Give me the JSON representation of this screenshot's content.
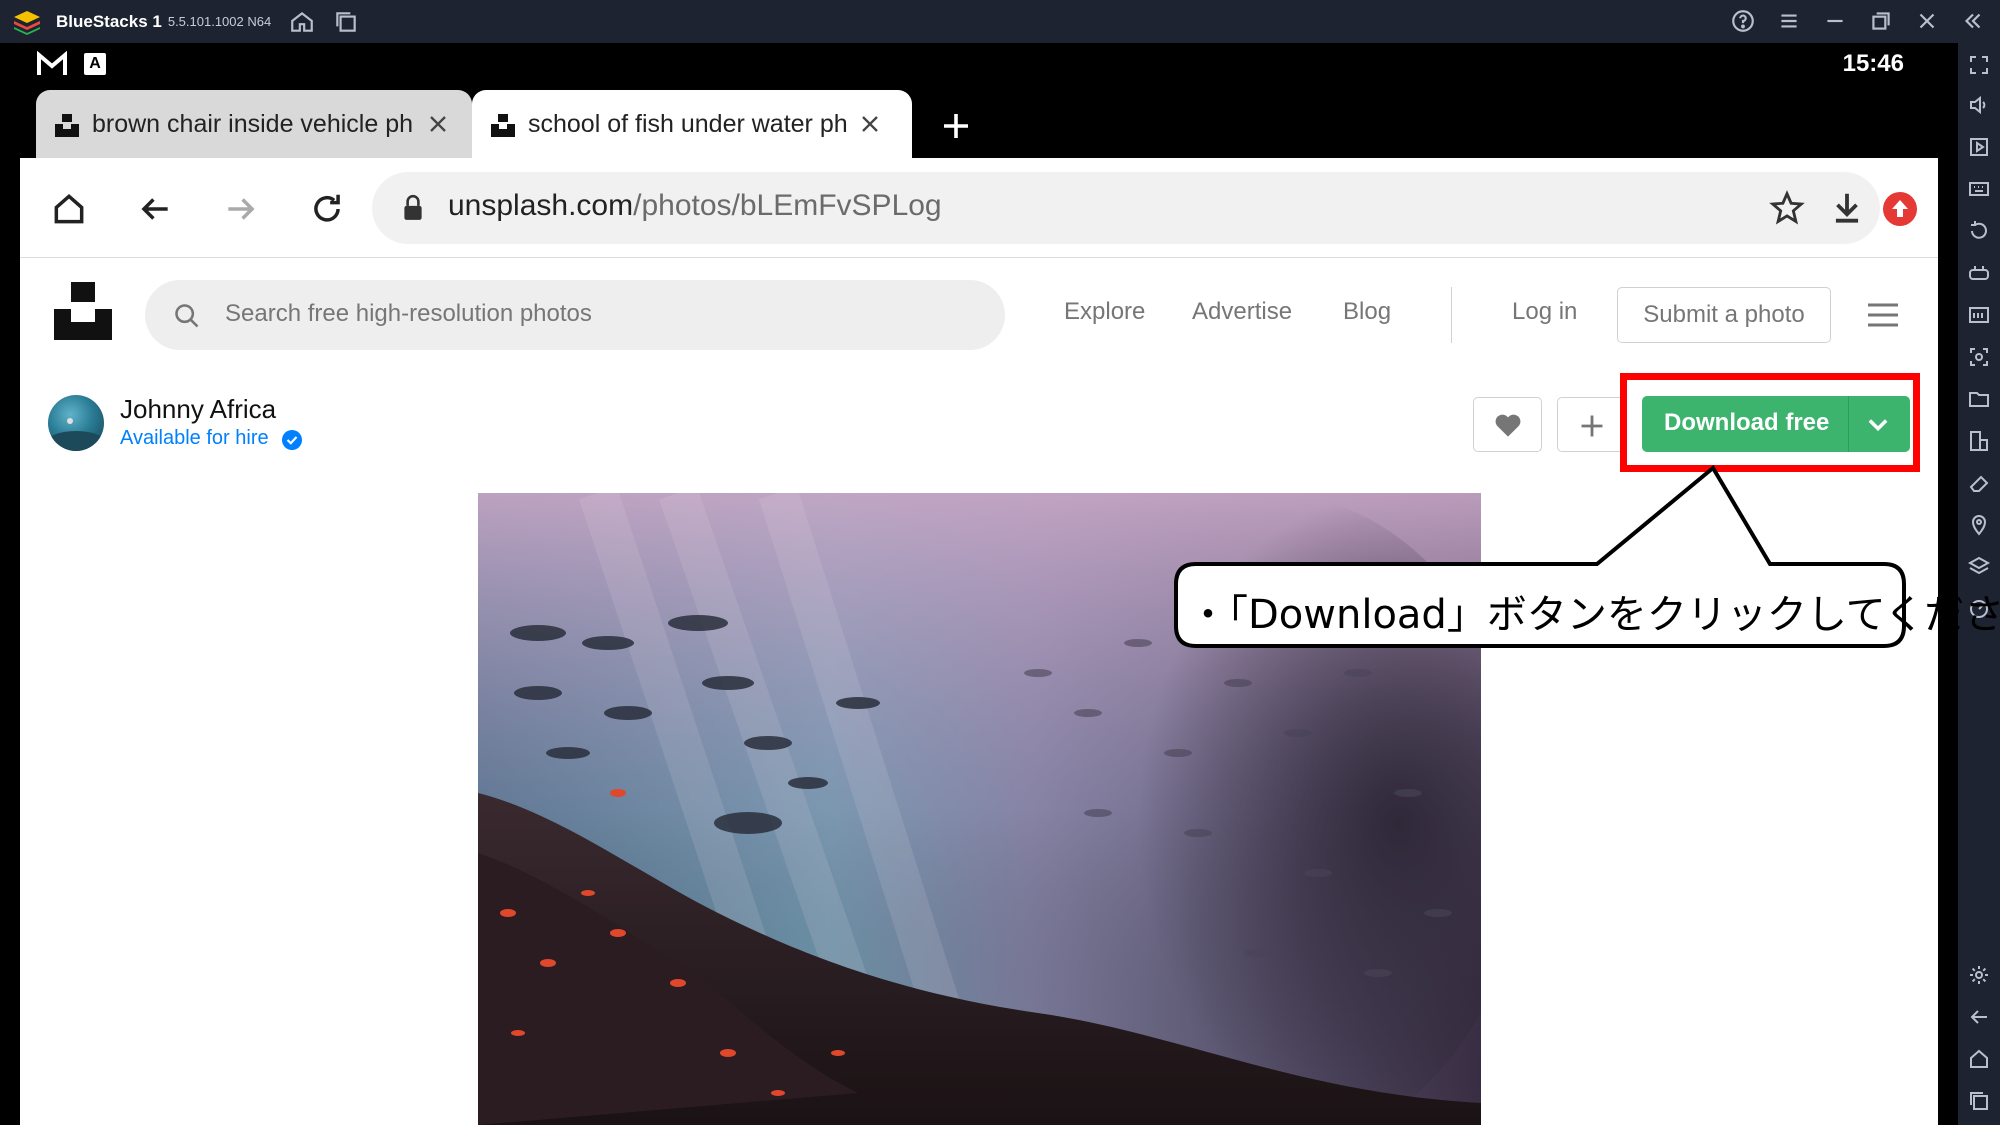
{
  "bluestacks": {
    "app_name": "BlueStacks 1",
    "version": "5.5.101.1002  N64"
  },
  "statusbar": {
    "time": "15:46"
  },
  "browser": {
    "tabs": [
      {
        "title": "brown chair inside vehicle ph",
        "active": false
      },
      {
        "title": "school of fish under water ph",
        "active": true
      }
    ],
    "url_domain": "unsplash.com",
    "url_path": "/photos/bLEmFvSPLog"
  },
  "unsplash": {
    "search_placeholder": "Search free high-resolution photos",
    "nav": {
      "explore": "Explore",
      "advertise": "Advertise",
      "blog": "Blog",
      "login": "Log in",
      "submit": "Submit a photo"
    },
    "author": {
      "name": "Johnny Africa",
      "hire": "Available for hire"
    },
    "download_label": "Download free",
    "accent_green": "#3cb46e"
  },
  "annotation": {
    "text": "・「Download」ボタンをクリックしてください",
    "highlight_color": "#ff0000"
  }
}
